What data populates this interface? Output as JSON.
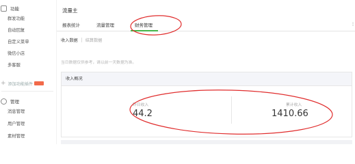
{
  "sidebar": {
    "section1_title": "功能",
    "section1_items": [
      "群发功能",
      "自动回复",
      "自定义菜单",
      "微信小店",
      "多客服"
    ],
    "add_plugin": "添加功能插件",
    "section2_title": "管理",
    "section2_items": [
      "消息管理",
      "用户管理",
      "素材管理"
    ]
  },
  "page": {
    "title": "流量主"
  },
  "tabs": [
    {
      "label": "报表统计"
    },
    {
      "label": "流量管理"
    },
    {
      "label": "财务管理"
    }
  ],
  "sub_tabs": {
    "income": "收入数据",
    "settlement": "结算数据"
  },
  "hint": "当日数据仅供参考，请以前一天数据为准。",
  "panel": {
    "title": "收入概况",
    "daily_label": "昨日收入",
    "daily_value": "44.2",
    "total_label": "累计收入",
    "total_value": "1410.66"
  },
  "colors": {
    "accent_green": "#44b549",
    "annotation_red": "#e02b2b",
    "new_badge": "#f26a4a"
  }
}
